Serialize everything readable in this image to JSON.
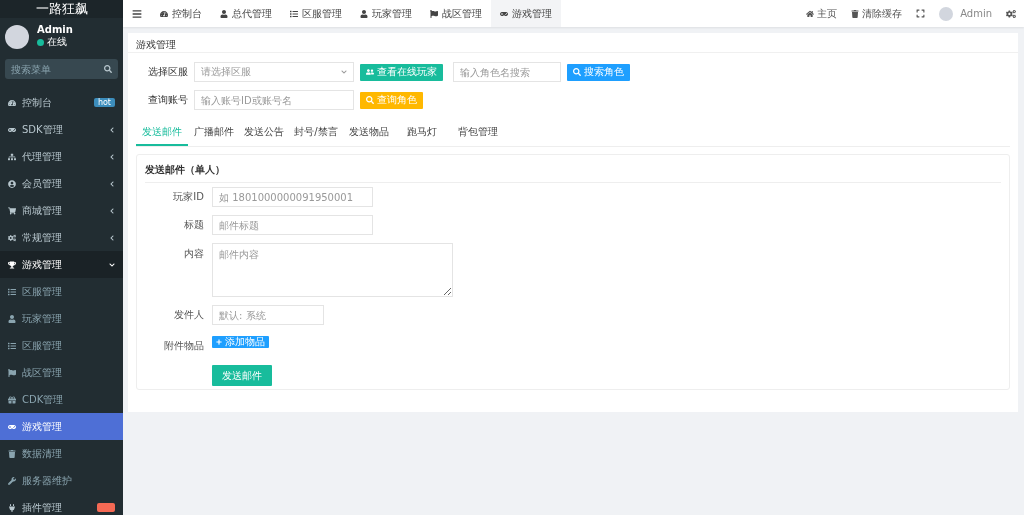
{
  "sidebar": {
    "logo": "一路狂飙",
    "user": {
      "name": "Admin",
      "status": "在线"
    },
    "search": {
      "placeholder": "搜索菜单"
    },
    "items": [
      {
        "label": "控制台",
        "badge": "hot",
        "expanded": false,
        "selected": false
      },
      {
        "label": "SDK管理",
        "expanded": false,
        "selected": false,
        "has_children": true
      },
      {
        "label": "代理管理",
        "expanded": false,
        "selected": false,
        "has_children": true
      },
      {
        "label": "会员管理",
        "expanded": false,
        "selected": false,
        "has_children": true
      },
      {
        "label": "商城管理",
        "expanded": false,
        "selected": false,
        "has_children": true
      },
      {
        "label": "常规管理",
        "expanded": false,
        "selected": false,
        "has_children": true
      },
      {
        "label": "游戏管理",
        "expanded": true,
        "selected": false,
        "children": [
          {
            "label": "区服管理",
            "selected": false
          },
          {
            "label": "玩家管理",
            "selected": false
          },
          {
            "label": "区服管理",
            "selected": false
          },
          {
            "label": "战区管理",
            "selected": false
          },
          {
            "label": "CDK管理",
            "selected": false
          },
          {
            "label": "游戏管理",
            "selected": true
          },
          {
            "label": "数据清理",
            "selected": false
          },
          {
            "label": "服务器维护",
            "selected": false
          }
        ]
      },
      {
        "label": "插件管理",
        "expanded": false,
        "selected": false,
        "has_children": false
      }
    ]
  },
  "topbar": {
    "tabs": [
      {
        "label": "控制台",
        "selected": false
      },
      {
        "label": "总代管理",
        "selected": false
      },
      {
        "label": "区服管理",
        "selected": false
      },
      {
        "label": "玩家管理",
        "selected": false
      },
      {
        "label": "战区管理",
        "selected": false
      },
      {
        "label": "游戏管理",
        "selected": true
      }
    ],
    "right": {
      "home": "主页",
      "clear_cache": "清除缓存",
      "user": "Admin"
    }
  },
  "page": {
    "title": "游戏管理",
    "filters": {
      "server_label": "选择区服",
      "server_placeholder": "请选择区服",
      "online_button": "查看在线玩家",
      "role_placeholder": "输入角色名搜索",
      "role_button": "搜索角色",
      "account_label": "查询账号",
      "account_placeholder": "输入账号ID或账号名",
      "account_button": "查询角色"
    },
    "tabs": [
      {
        "label": "发送邮件",
        "selected": true
      },
      {
        "label": "广播邮件",
        "selected": false
      },
      {
        "label": "发送公告",
        "selected": false
      },
      {
        "label": "封号/禁言",
        "selected": false
      },
      {
        "label": "发送物品",
        "selected": false
      },
      {
        "label": "跑马灯",
        "selected": false
      },
      {
        "label": "背包管理",
        "selected": false
      }
    ],
    "form": {
      "title": "发送邮件（单人）",
      "fields": [
        {
          "label": "玩家ID",
          "placeholder": "如 1801000000091950001",
          "kind": "input"
        },
        {
          "label": "标题",
          "placeholder": "邮件标题",
          "kind": "input"
        },
        {
          "label": "内容",
          "placeholder": "邮件内容",
          "kind": "textarea"
        },
        {
          "label": "发件人",
          "placeholder": "默认: 系统",
          "kind": "short"
        }
      ],
      "attach_label": "附件物品",
      "attach_button": "添加物品",
      "submit": "发送邮件"
    }
  }
}
